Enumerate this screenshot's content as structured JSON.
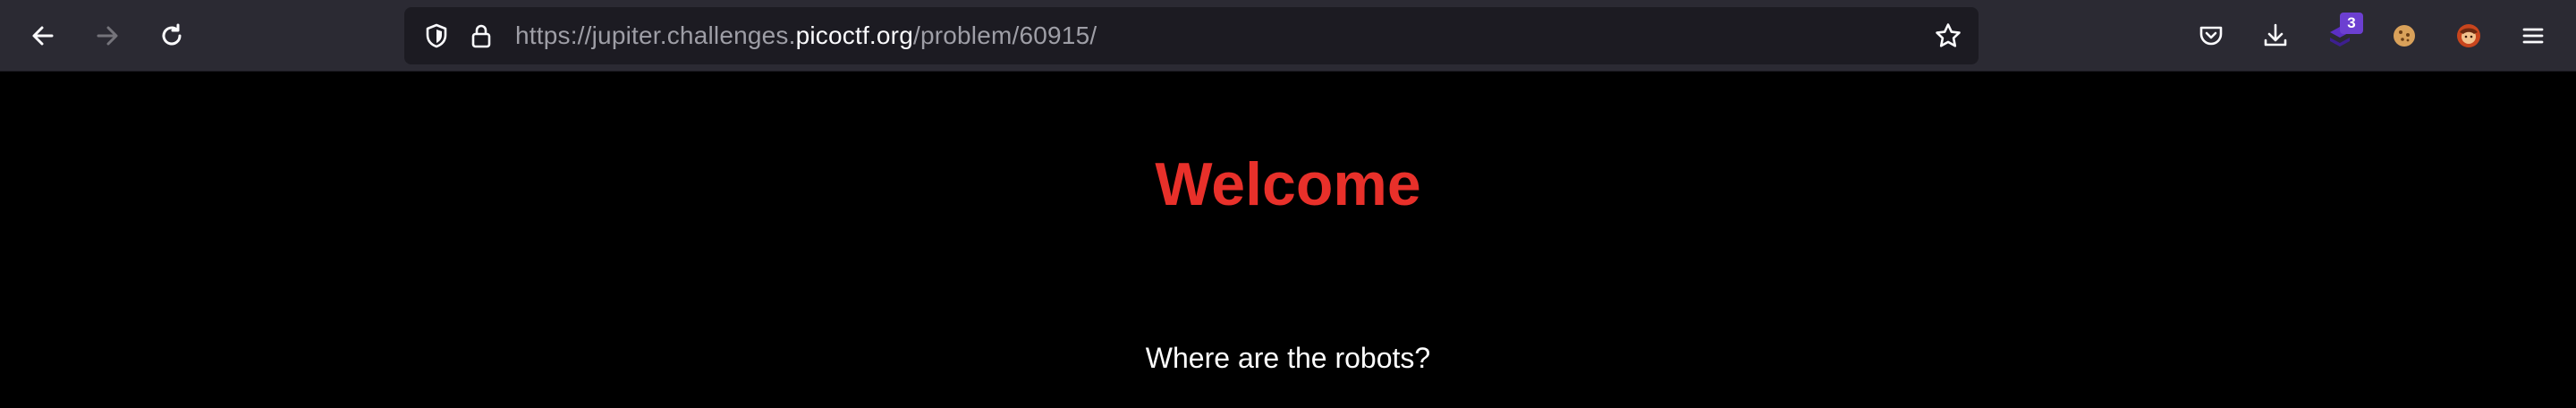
{
  "browser": {
    "url": {
      "prefix": "https://jupiter.challenges.",
      "host": "picoctf.org",
      "path": "/problem/60915/"
    },
    "extension_badge_count": "3",
    "icons": [
      "back-arrow-icon",
      "forward-arrow-icon",
      "reload-icon",
      "shield-icon",
      "lock-icon",
      "star-icon",
      "pocket-icon",
      "download-icon",
      "extension-icon",
      "cookie-icon",
      "avatar-extension-icon",
      "hamburger-menu-icon"
    ]
  },
  "page": {
    "heading": "Welcome",
    "message": "Where are the robots?"
  },
  "colors": {
    "toolbar_bg": "#2b2a33",
    "urlbar_bg": "#1c1b22",
    "page_bg": "#000000",
    "heading_color": "#e8302a",
    "message_color": "#ffffff"
  }
}
